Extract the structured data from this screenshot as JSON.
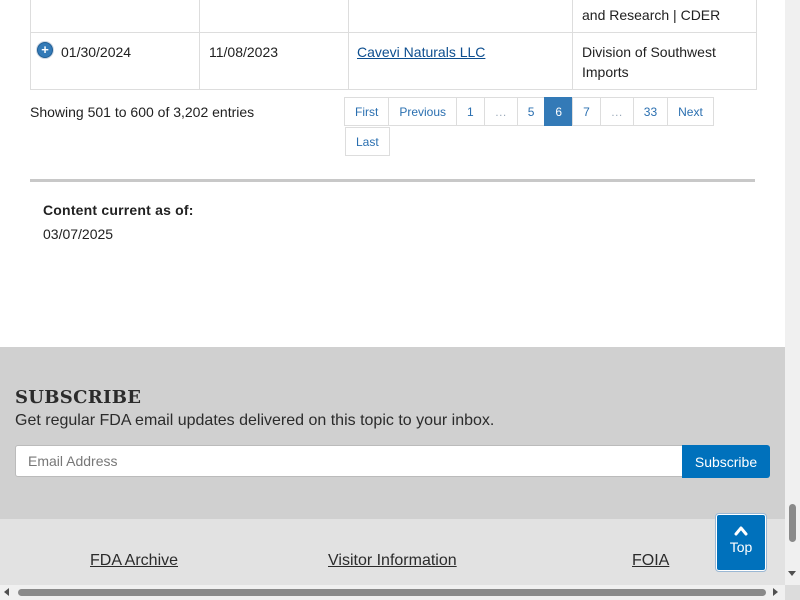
{
  "table": {
    "top_row": {
      "col4": "and Research | CDER"
    },
    "row": {
      "expand_icon": "plus-circle-icon",
      "posted_date": "01/30/2024",
      "letter_date": "11/08/2023",
      "company": "Cavevi Naturals LLC",
      "issuing_office": "Division of Southwest Imports"
    }
  },
  "entries_info": "Showing 501 to 600 of 3,202 entries",
  "pagination": {
    "first": "First",
    "previous": "Previous",
    "p1": "1",
    "ellipsis_left": "…",
    "p5": "5",
    "current": "6",
    "p7": "7",
    "ellipsis_right": "…",
    "p33": "33",
    "next": "Next",
    "last": "Last"
  },
  "content_current": {
    "label": "Content current as of:",
    "date": "03/07/2025"
  },
  "subscribe": {
    "title": "SUBSCRIBE",
    "description": "Get regular FDA email updates delivered on this topic to your inbox.",
    "email_placeholder": "Email Address",
    "button": "Subscribe"
  },
  "footer": {
    "links": [
      "FDA Archive",
      "Visitor Information",
      "FOIA"
    ]
  },
  "back_to_top": {
    "icon": "chevron-up-icon",
    "label": "Top"
  },
  "colors": {
    "accent": "#0071bc",
    "pagination_active": "#337ab7",
    "subscribe_bg": "#d0d0d0",
    "footer_bg": "#e2e2e2"
  }
}
